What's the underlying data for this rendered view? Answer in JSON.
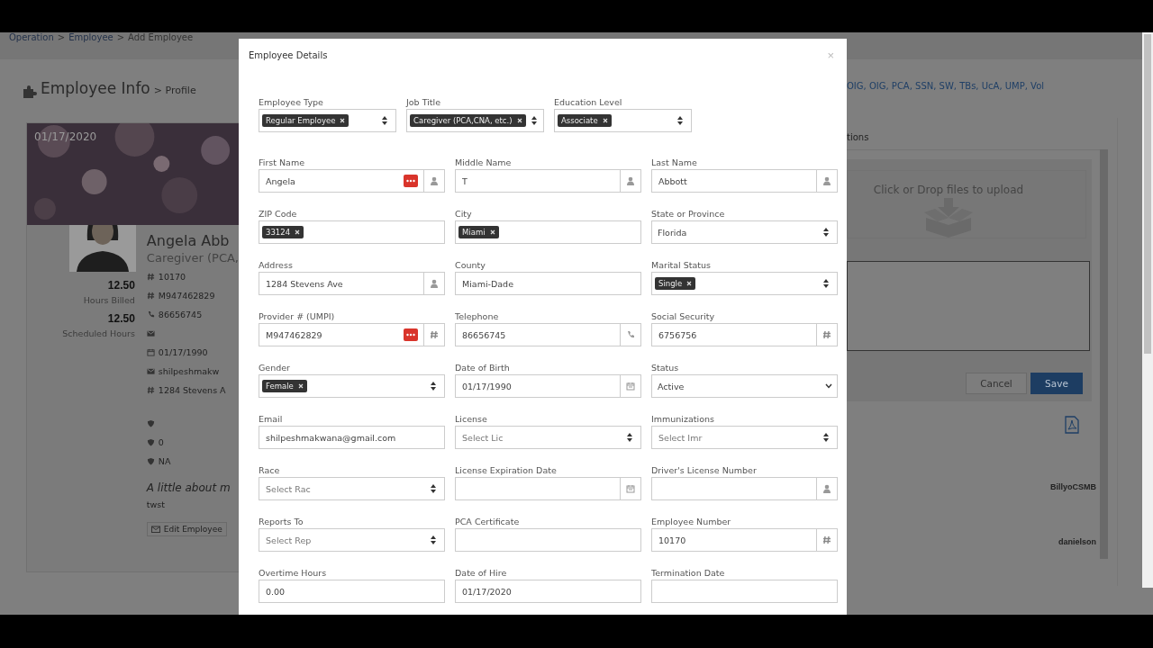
{
  "breadcrumb": {
    "items": [
      "Operation",
      "Employee",
      "Add Employee"
    ],
    "separator": ">"
  },
  "page_title": {
    "title": "Employee Info",
    "subtitle": "> Profile"
  },
  "profile": {
    "banner_date": "01/17/2020",
    "stats": [
      {
        "value": "12.50",
        "label": "Hours Billed"
      },
      {
        "value": "12.50",
        "label": "Scheduled Hours"
      }
    ],
    "name": "Angela Abb",
    "job": "Caregiver (PCA,",
    "details": [
      {
        "kind": "hash",
        "text": "10170"
      },
      {
        "kind": "hash",
        "text": "M947462829"
      },
      {
        "kind": "phone",
        "text": "86656745"
      },
      {
        "kind": "mail"
      },
      {
        "kind": "calendar",
        "text": "01/17/1990"
      },
      {
        "kind": "mail",
        "text": "shilpeshmakw"
      },
      {
        "kind": "hash",
        "text": "1284 Stevens A"
      }
    ],
    "badges": [
      {
        "kind": "shield"
      },
      {
        "kind": "shield",
        "text": "0"
      },
      {
        "kind": "shield",
        "text": "NA"
      }
    ],
    "about_heading": "A little about m",
    "about_text": "twst",
    "edit_button": "Edit Employee"
  },
  "right": {
    "certifications": "OIG, OIG, PCA, SSN, SW, TBs, UcA, UMP, Vol",
    "tab_fragment": "tions",
    "dropzone": "Click or Drop files to upload",
    "cancel": "Cancel",
    "save": "Save",
    "users": [
      "BillyoCSMB",
      "danielson"
    ]
  },
  "modal": {
    "title": "Employee Details",
    "close": "×",
    "rows": [
      [
        {
          "label": "Employee Type",
          "kind": "tags",
          "tags": [
            "Regular Employee"
          ]
        },
        {
          "label": "Job Title",
          "kind": "tags",
          "tags": [
            "Caregiver (PCA,CNA, etc.)"
          ]
        },
        {
          "label": "Education Level",
          "kind": "tags",
          "tags": [
            "Associate"
          ]
        }
      ],
      [
        {
          "label": "First Name",
          "kind": "text-person",
          "value": "Angela",
          "autofill": true
        },
        {
          "label": "Middle Name",
          "kind": "text-person",
          "value": "T",
          "autofill": false
        },
        {
          "label": "Last Name",
          "kind": "text-person",
          "value": "Abbott",
          "autofill": false
        }
      ],
      [
        {
          "label": "ZIP Code",
          "kind": "tags-plain",
          "tags": [
            "33124"
          ]
        },
        {
          "label": "City",
          "kind": "tags-plain",
          "tags": [
            "Miami"
          ]
        },
        {
          "label": "State or Province",
          "kind": "dropdown-updown",
          "value": "Florida"
        }
      ],
      [
        {
          "label": "Address",
          "kind": "text-person",
          "value": "1284 Stevens Ave",
          "autofill": false
        },
        {
          "label": "County",
          "kind": "text",
          "value": "Miami-Dade",
          "autofill": false
        },
        {
          "label": "Marital Status",
          "kind": "tags",
          "tags": [
            "Single"
          ]
        }
      ],
      [
        {
          "label": "Provider # (UMPI)",
          "kind": "text-hash",
          "value": "M947462829",
          "autofill": true
        },
        {
          "label": "Telephone",
          "kind": "text-phone",
          "value": "86656745",
          "autofill": false
        },
        {
          "label": "Social Security",
          "kind": "text-hash",
          "value": "6756756",
          "autofill": false
        }
      ],
      [
        {
          "label": "Gender",
          "kind": "tags",
          "tags": [
            "Female"
          ]
        },
        {
          "label": "Date of Birth",
          "kind": "text-calendar",
          "value": "01/17/1990",
          "autofill": false
        },
        {
          "label": "Status",
          "kind": "dropdown-chevron",
          "value": "Active"
        }
      ],
      [
        {
          "label": "Email",
          "kind": "text",
          "value": "shilpeshmakwana@gmail.com",
          "autofill": false
        },
        {
          "label": "License",
          "kind": "select",
          "placeholder": "Select Lic"
        },
        {
          "label": "Immunizations",
          "kind": "select",
          "placeholder": "Select Imr"
        }
      ],
      [
        {
          "label": "Race",
          "kind": "select",
          "placeholder": "Select Rac"
        },
        {
          "label": "License Expiration Date",
          "kind": "text-calendar",
          "autofill": false
        },
        {
          "label": "Driver's License Number",
          "kind": "text-person",
          "autofill": false
        }
      ],
      [
        {
          "label": "Reports To",
          "kind": "select",
          "placeholder": "Select Rep"
        },
        {
          "label": "PCA Certificate",
          "kind": "text",
          "autofill": false
        },
        {
          "label": "Employee Number",
          "kind": "text-hash",
          "value": "10170",
          "autofill": false
        }
      ],
      [
        {
          "label": "Overtime Hours",
          "kind": "text",
          "value": "0.00",
          "autofill": false
        },
        {
          "label": "Date of Hire",
          "kind": "text",
          "value": "01/17/2020",
          "autofill": false
        },
        {
          "label": "Termination Date",
          "kind": "text",
          "autofill": false
        }
      ]
    ]
  }
}
